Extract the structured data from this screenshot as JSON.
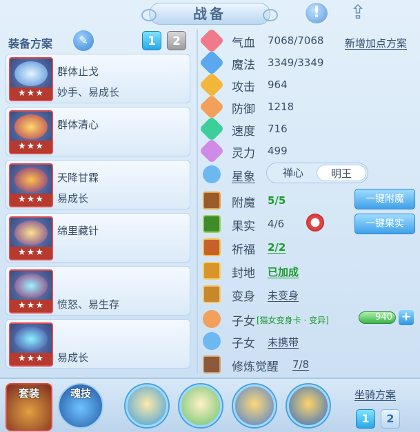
{
  "title": "战备",
  "left": {
    "heading": "装备方案",
    "plan_tabs": [
      "1",
      "2"
    ],
    "plans": [
      {
        "name": "群体止戈",
        "desc": "妙手、易成长",
        "stars": "★★★"
      },
      {
        "name": "群体清心",
        "desc": "",
        "stars": "★★★"
      },
      {
        "name": "天降甘霖",
        "desc": "易成长",
        "stars": "★★★"
      },
      {
        "name": "绵里藏针",
        "desc": "",
        "stars": "★★★"
      },
      {
        "name": "",
        "desc": "愤怒、易生存",
        "stars": "★★★"
      },
      {
        "name": "",
        "desc": "易成长",
        "stars": "★★★"
      }
    ]
  },
  "stats": {
    "add_plan_label": "新增加点方案",
    "hp": {
      "label": "气血",
      "value": "7068/7068"
    },
    "mp": {
      "label": "魔法",
      "value": "3349/3349"
    },
    "atk": {
      "label": "攻击",
      "value": "964"
    },
    "def": {
      "label": "防御",
      "value": "1218"
    },
    "spd": {
      "label": "速度",
      "value": "716"
    },
    "spi": {
      "label": "灵力",
      "value": "499"
    },
    "star": {
      "label": "星象",
      "options": [
        "禅心",
        "明王"
      ],
      "selected": "明王"
    },
    "enchant": {
      "label": "附魔",
      "value": "5/5",
      "button": "一键附魔"
    },
    "fruit": {
      "label": "果实",
      "value": "4/6",
      "button": "一键果实"
    },
    "bless": {
      "label": "祈福",
      "value": "2/2"
    },
    "seal": {
      "label": "封地",
      "value": "已加成"
    },
    "transform": {
      "label": "变身",
      "value": "未变身"
    },
    "child1": {
      "label": "子女",
      "tag": "[猫女变身卡 · 变异]",
      "value": "940"
    },
    "child2": {
      "label": "子女",
      "value": "未携带"
    },
    "awaken": {
      "label": "修炼觉醒",
      "value": "7/8"
    }
  },
  "bottom": {
    "tabs": [
      "套装",
      "魂技"
    ],
    "mount_label": "坐骑方案",
    "mount_tabs": [
      "1",
      "2"
    ]
  },
  "colors": {
    "accent_blue": "#2aa7e8",
    "green_value": "#1e9b2c",
    "star_red": "#b63a2e"
  }
}
